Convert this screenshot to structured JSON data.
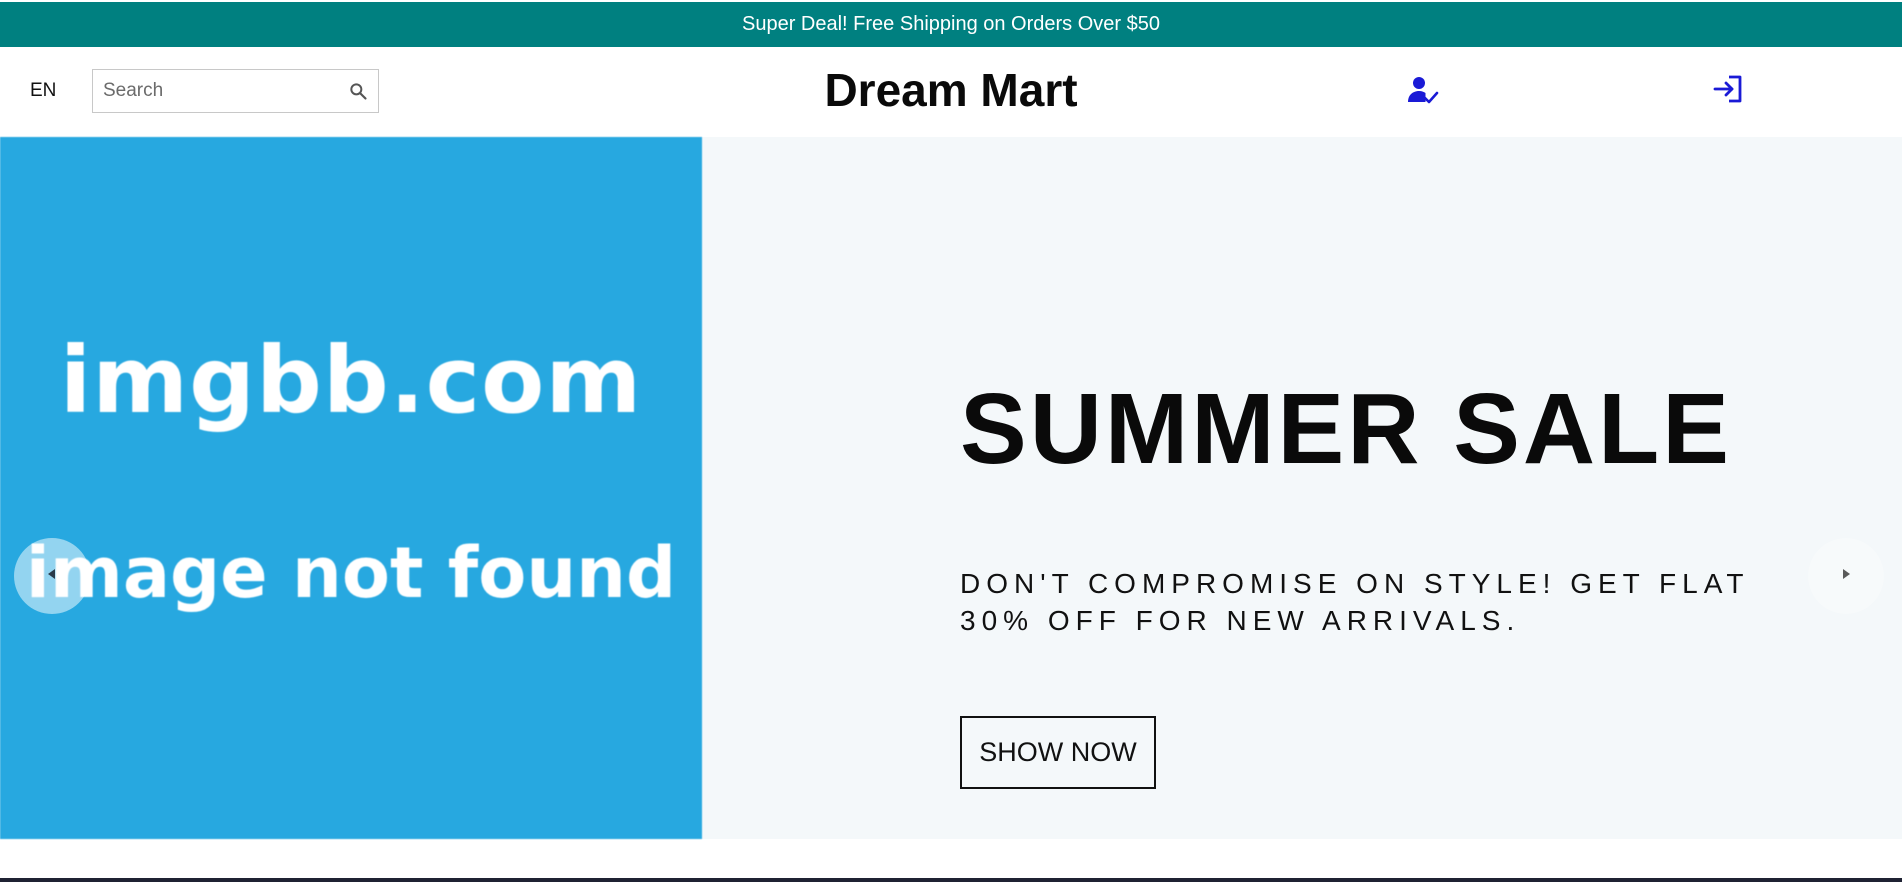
{
  "announcement": {
    "text": "Super Deal! Free Shipping on Orders Over $50",
    "background": "#008080"
  },
  "header": {
    "language": "EN",
    "search": {
      "placeholder": "Search",
      "value": "",
      "icon": "search-icon"
    },
    "logo": "Dream Mart",
    "user_icon": "user-check-icon",
    "login_icon": "login-icon",
    "icon_color": "#1a1ad6"
  },
  "hero": {
    "image_text": {
      "line1": "imgbb.com",
      "line2": "image not found"
    },
    "image_background": "#27a8e0",
    "title": "SUMMER SALE",
    "subtitle": "DON'T COMPROMISE ON STYLE! GET FLAT 30% OFF FOR NEW ARRIVALS.",
    "cta_label": "SHOW NOW",
    "prev_icon": "caret-left-icon",
    "next_icon": "caret-right-icon"
  }
}
